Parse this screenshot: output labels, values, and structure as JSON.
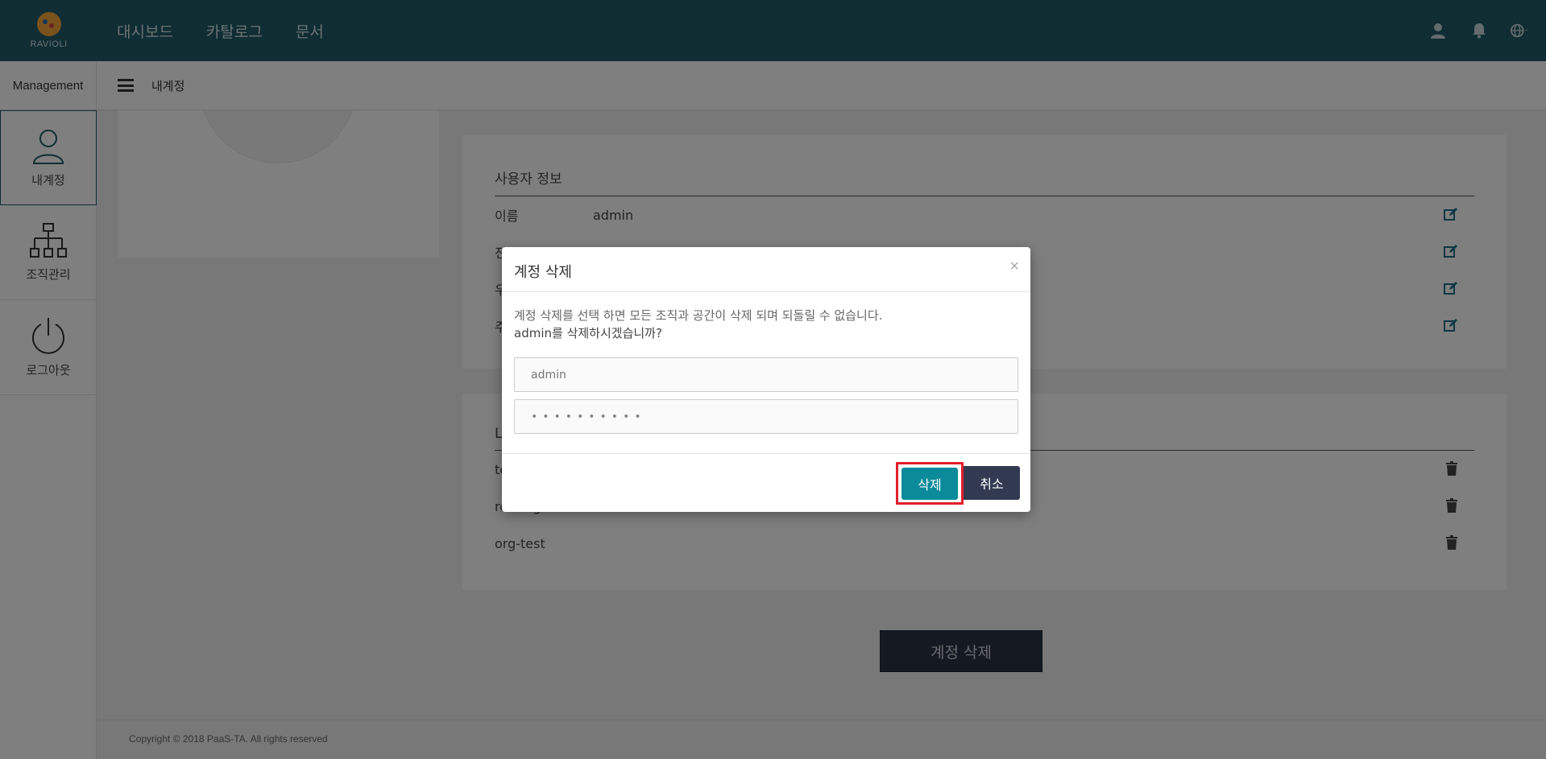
{
  "topbar": {
    "logo_text": "RAVIOLI",
    "nav": [
      "대시보드",
      "카탈로그",
      "문서"
    ]
  },
  "subheader": {
    "section_label": "Management",
    "breadcrumb": "내계정"
  },
  "sidebar": {
    "items": [
      {
        "label": "내계정",
        "icon": "user-icon"
      },
      {
        "label": "조직관리",
        "icon": "org-chart-icon"
      },
      {
        "label": "로그아웃",
        "icon": "power-icon"
      }
    ]
  },
  "user_info": {
    "title": "사용자 정보",
    "rows": [
      {
        "key": "이름",
        "value": "admin"
      },
      {
        "key": "전",
        "value": ""
      },
      {
        "key": "우",
        "value": ""
      },
      {
        "key": "주",
        "value": ""
      }
    ]
  },
  "org_list": {
    "title": "L",
    "rows": [
      "te",
      "rex-org",
      "org-test"
    ]
  },
  "delete_account_button": "계정 삭제",
  "footer": "Copyright © 2018 PaaS-TA. All rights reserved",
  "modal": {
    "title": "계정 삭제",
    "close": "×",
    "message_line1": "계정 삭제를 선택 하면 모든 조직과 공간이 삭제 되며 되돌릴 수 없습니다.",
    "message_line2": "admin를 삭제하시겠습니까?",
    "username_value": "admin",
    "password_mask": "••••••••••",
    "confirm_label": "삭제",
    "cancel_label": "취소"
  },
  "colors": {
    "topbar": "#1f5a66",
    "confirm": "#0b8b9a",
    "cancel": "#323a52",
    "highlight": "#e11f2c"
  }
}
